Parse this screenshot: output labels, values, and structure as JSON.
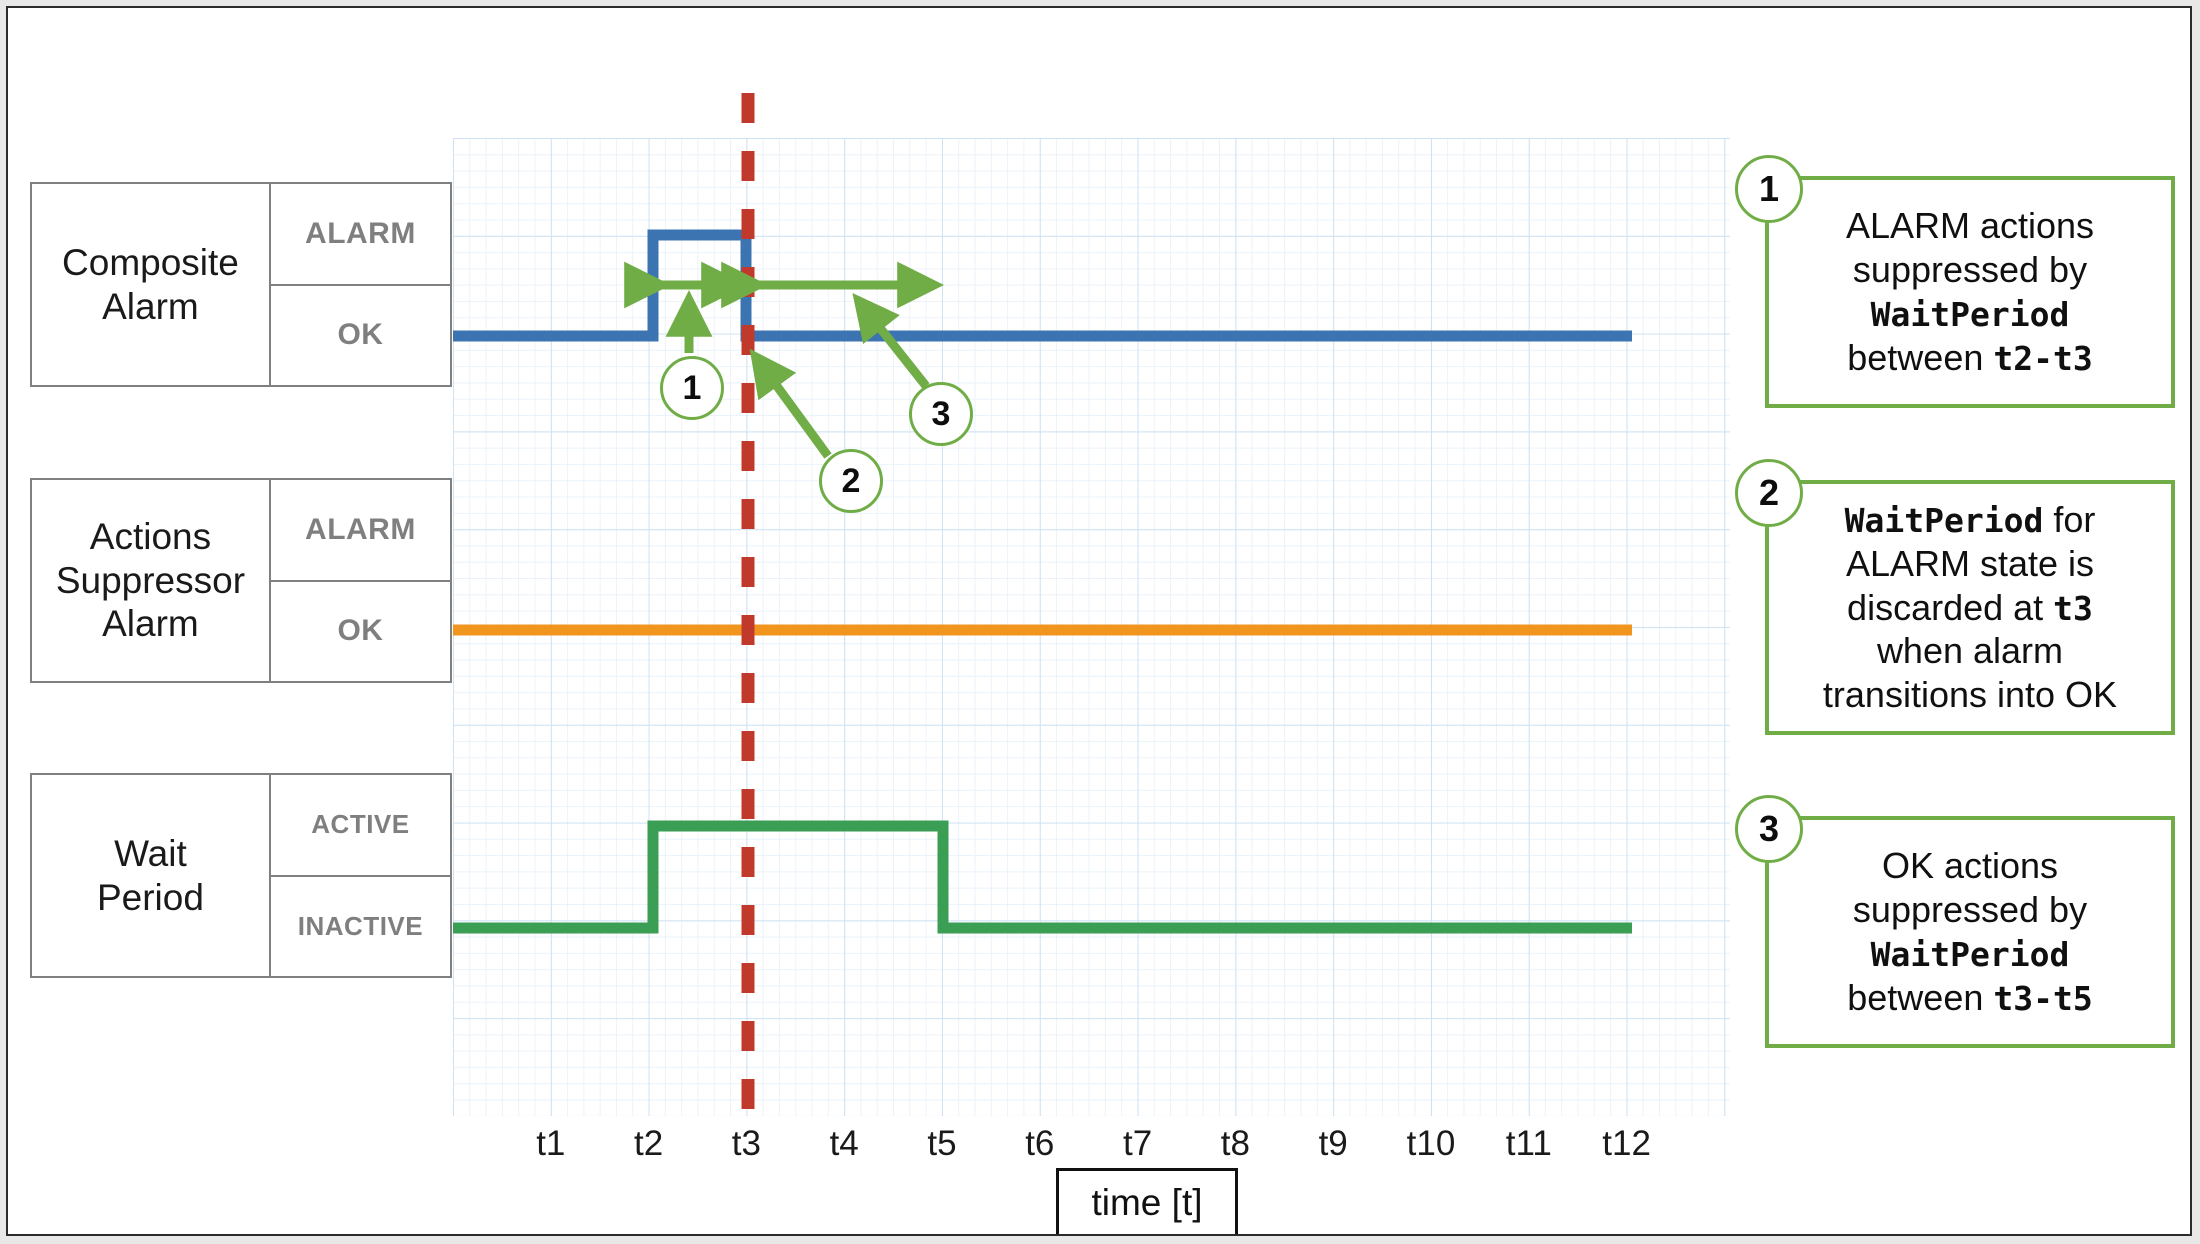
{
  "rows": [
    {
      "name": "Composite\nAlarm",
      "name_line1": "Composite",
      "name_line2": "Alarm",
      "high_label": "ALARM",
      "low_label": "OK",
      "color": "#3b74b0"
    },
    {
      "name": "Actions Suppressor Alarm",
      "name_line1": "Actions",
      "name_line2": "Suppressor",
      "name_line3": "Alarm",
      "high_label": "ALARM",
      "low_label": "OK",
      "color": "#f2951f"
    },
    {
      "name": "Wait Period",
      "name_line1": "Wait",
      "name_line2": "Period",
      "high_label": "ACTIVE",
      "low_label": "INACTIVE",
      "color": "#3a9e54"
    }
  ],
  "axis": {
    "label": "time [t]",
    "ticks": [
      "t1",
      "t2",
      "t3",
      "t4",
      "t5",
      "t6",
      "t7",
      "t8",
      "t9",
      "t10",
      "t11",
      "t12"
    ]
  },
  "markers": {
    "now_line_tick": "t3",
    "badge1": "1",
    "badge2": "2",
    "badge3": "3"
  },
  "callouts": [
    {
      "number": "1",
      "line1": "ALARM actions",
      "line2": "suppressed by",
      "line3": "WaitPeriod",
      "line4_pre": "between ",
      "line4_mono": "t2-t3"
    },
    {
      "number": "2",
      "line1_mono": "WaitPeriod",
      "line1_post": " for",
      "line2": "ALARM state is",
      "line3_pre": "discarded at ",
      "line3_mono": "t3",
      "line4": "when alarm",
      "line5": "transitions into OK"
    },
    {
      "number": "3",
      "line1": "OK actions",
      "line2": "suppressed by",
      "line3": "WaitPeriod",
      "line4_pre": "between ",
      "line4_mono": "t3-t5"
    }
  ],
  "chart_data": {
    "type": "line",
    "title": "",
    "xlabel": "time [t]",
    "ylabel": "",
    "grid": true,
    "legend": "none",
    "x": [
      "t1",
      "t2",
      "t3",
      "t4",
      "t5",
      "t6",
      "t7",
      "t8",
      "t9",
      "t10",
      "t11",
      "t12"
    ],
    "xlim": [
      "t0",
      "t12"
    ],
    "series": [
      {
        "name": "Composite Alarm",
        "color": "#3b74b0",
        "states": [
          "OK",
          "ALARM"
        ],
        "step_points": [
          {
            "t": "t0",
            "state": "OK"
          },
          {
            "t": "t2",
            "state": "ALARM"
          },
          {
            "t": "t3",
            "state": "OK"
          },
          {
            "t": "t12",
            "state": "OK"
          }
        ]
      },
      {
        "name": "Actions Suppressor Alarm",
        "color": "#f2951f",
        "states": [
          "OK",
          "ALARM"
        ],
        "step_points": [
          {
            "t": "t0",
            "state": "OK"
          },
          {
            "t": "t12",
            "state": "OK"
          }
        ]
      },
      {
        "name": "Wait Period",
        "color": "#3a9e54",
        "states": [
          "INACTIVE",
          "ACTIVE"
        ],
        "step_points": [
          {
            "t": "t0",
            "state": "INACTIVE"
          },
          {
            "t": "t2",
            "state": "ACTIVE"
          },
          {
            "t": "t5",
            "state": "INACTIVE"
          },
          {
            "t": "t12",
            "state": "INACTIVE"
          }
        ]
      }
    ],
    "vertical_marker": {
      "t": "t3",
      "color": "#c0392b",
      "style": "dashed"
    },
    "span_annotations": [
      {
        "id": "1",
        "from": "t2",
        "to": "t3",
        "color": "#70ad47"
      },
      {
        "id": "3",
        "from": "t3",
        "to": "t5",
        "color": "#70ad47"
      }
    ],
    "point_annotations": [
      {
        "id": "2",
        "t": "t3",
        "color": "#70ad47"
      }
    ]
  }
}
